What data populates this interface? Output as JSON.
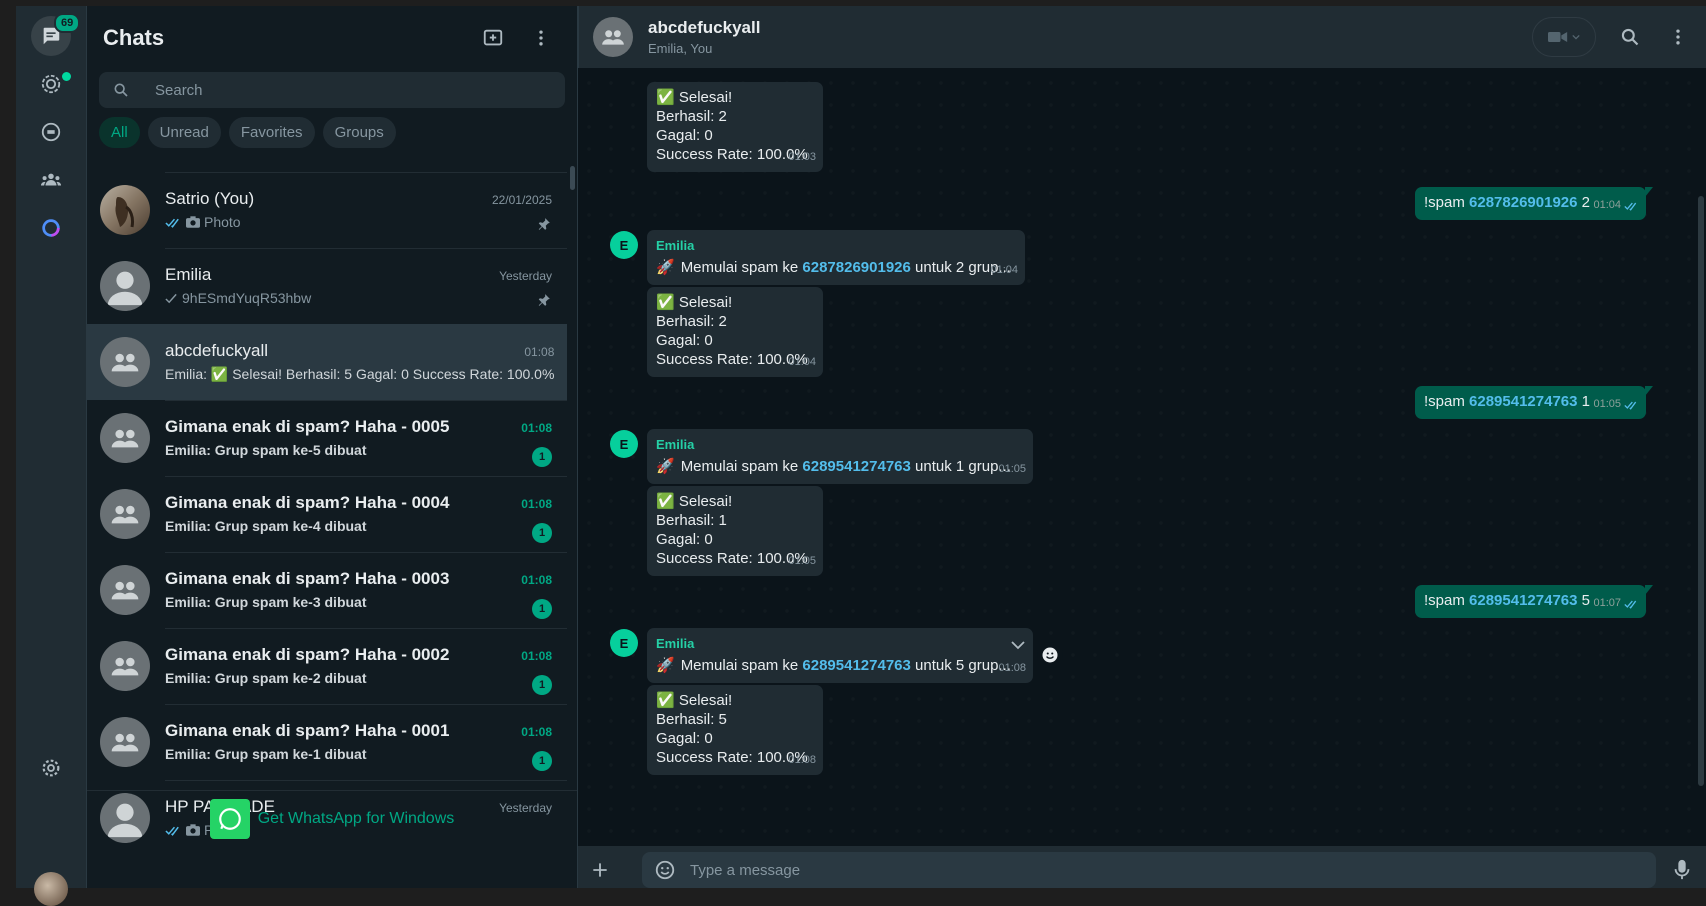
{
  "rail": {
    "badge": "69",
    "colors": {
      "accent": "#00a884",
      "bg": "#202c33"
    }
  },
  "sidebar": {
    "title": "Chats",
    "search_placeholder": "Search",
    "filters": [
      "All",
      "Unread",
      "Favorites",
      "Groups"
    ],
    "active_filter": "All",
    "chats": [
      {
        "name": "Satrio (You)",
        "preview": "Photo",
        "time": "22/01/2025",
        "pinned": true,
        "ticks": "double",
        "photo": true,
        "avatar": "photo",
        "bold": false
      },
      {
        "name": "Emilia",
        "preview": "9hESmdYuqR53hbw",
        "time": "Yesterday",
        "pinned": true,
        "ticks": "single",
        "photo": false,
        "avatar": "person",
        "bold": false
      },
      {
        "name": "abcdefuckyall",
        "preview": "Emilia: ✅ Selesai! Berhasil: 5 Gagal: 0 Success Rate: 100.0%",
        "time": "01:08",
        "selected": true,
        "avatar": "group",
        "bold": false
      },
      {
        "name": "Gimana enak di spam? Haha - 0005",
        "preview": "Emilia: Grup spam ke-5 dibuat",
        "time": "01:08",
        "unread": "1",
        "avatar": "group",
        "bold": true
      },
      {
        "name": "Gimana enak di spam? Haha - 0004",
        "preview": "Emilia: Grup spam ke-4 dibuat",
        "time": "01:08",
        "unread": "1",
        "avatar": "group",
        "bold": true
      },
      {
        "name": "Gimana enak di spam? Haha - 0003",
        "preview": "Emilia: Grup spam ke-3 dibuat",
        "time": "01:08",
        "unread": "1",
        "avatar": "group",
        "bold": true
      },
      {
        "name": "Gimana enak di spam? Haha - 0002",
        "preview": "Emilia: Grup spam ke-2 dibuat",
        "time": "01:08",
        "unread": "1",
        "avatar": "group",
        "bold": true
      },
      {
        "name": "Gimana enak di spam? Haha - 0001",
        "preview": "Emilia: Grup spam ke-1 dibuat",
        "time": "01:08",
        "unread": "1",
        "avatar": "group",
        "bold": true
      },
      {
        "name": "HP PALISADE",
        "preview": "Photo",
        "time": "Yesterday",
        "ticks": "double",
        "photo": true,
        "avatar": "person",
        "bold": false
      }
    ],
    "promo": "Get WhatsApp for Windows"
  },
  "conversation": {
    "title": "abcdefuckyall",
    "subtitle": "Emilia, You",
    "composer_placeholder": "Type a message",
    "messages": [
      {
        "kind": "in",
        "lines": [
          "✅ Selesai!",
          "Berhasil: 2",
          "Gagal: 0",
          "Success Rate: 100.0%"
        ],
        "time": "01:03",
        "check": true
      },
      {
        "kind": "out",
        "prefix": "!spam ",
        "number": "6287826901926",
        "suffix": " 2",
        "time": "01:04"
      },
      {
        "kind": "in-start",
        "sender": "Emilia",
        "prefix": "Memulai spam ke ",
        "number": "6287826901926",
        "suffix": " untuk 2 grup...",
        "time": "01:04"
      },
      {
        "kind": "in",
        "lines": [
          "✅ Selesai!",
          "Berhasil: 2",
          "Gagal: 0",
          "Success Rate: 100.0%"
        ],
        "time": "01:04",
        "check": true
      },
      {
        "kind": "out",
        "prefix": "!spam ",
        "number": "6289541274763",
        "suffix": " 1",
        "time": "01:05"
      },
      {
        "kind": "in-start",
        "sender": "Emilia",
        "prefix": "Memulai spam ke ",
        "number": "6289541274763",
        "suffix": " untuk 1 grup...",
        "time": "01:05"
      },
      {
        "kind": "in",
        "lines": [
          "✅ Selesai!",
          "Berhasil: 1",
          "Gagal: 0",
          "Success Rate: 100.0%"
        ],
        "time": "01:05",
        "check": true
      },
      {
        "kind": "out",
        "prefix": "!spam ",
        "number": "6289541274763",
        "suffix": " 5",
        "time": "01:07"
      },
      {
        "kind": "in-start",
        "sender": "Emilia",
        "prefix": "Memulai spam ke ",
        "number": "6289541274763",
        "suffix": " untuk 5 grup...",
        "time": "01:08"
      },
      {
        "kind": "in",
        "lines": [
          "✅ Selesai!",
          "Berhasil: 5",
          "Gagal: 0",
          "Success Rate: 100.0%"
        ],
        "time": "01:08",
        "check": true
      }
    ],
    "sender_initial": "E"
  }
}
